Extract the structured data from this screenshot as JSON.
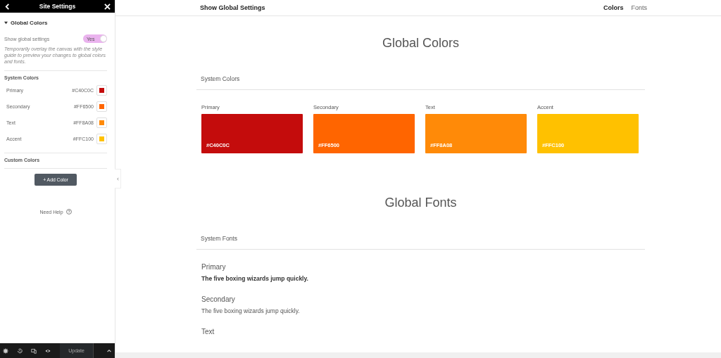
{
  "sidebar": {
    "title": "Site Settings",
    "section": "Global Colors",
    "expanded": true,
    "toggle": {
      "label": "Show global settings",
      "value": "Yes",
      "on": true
    },
    "hint": "Temporarily overlay the canvas with the style guide to preview your changes to global colors and fonts.",
    "system_colors_heading": "System Colors",
    "colors": [
      {
        "name": "Primary",
        "hex": "#C40C0C",
        "color": "#c40c0c"
      },
      {
        "name": "Secondary",
        "hex": "#FF6500",
        "color": "#ff6500"
      },
      {
        "name": "Text",
        "hex": "#FF8A08",
        "color": "#ff8a08"
      },
      {
        "name": "Accent",
        "hex": "#FFC100",
        "color": "#ffc100"
      }
    ],
    "custom_colors_heading": "Custom Colors",
    "add_button": "+ Add Color",
    "help": "Need Help"
  },
  "footer": {
    "update_button": "Update"
  },
  "topbar": {
    "title": "Show Global Settings",
    "tabs": [
      {
        "label": "Colors",
        "selected": true
      },
      {
        "label": "Fonts",
        "selected": false
      }
    ]
  },
  "colors_section": {
    "title": "Global Colors",
    "heading": "System Colors",
    "swatches": [
      {
        "name": "Primary",
        "hex": "#C40C0C",
        "color": "#c40c0c"
      },
      {
        "name": "Secondary",
        "hex": "#FF6500",
        "color": "#ff6500"
      },
      {
        "name": "Text",
        "hex": "#FF8A08",
        "color": "#ff8a08"
      },
      {
        "name": "Accent",
        "hex": "#FFC100",
        "color": "#ffc100"
      }
    ]
  },
  "fonts_section": {
    "title": "Global Fonts",
    "heading": "System Fonts",
    "fonts": [
      {
        "name": "Primary",
        "sample": "The five boxing wizards jump quickly.",
        "bold": true
      },
      {
        "name": "Secondary",
        "sample": "The five boxing wizards jump quickly.",
        "bold": false
      },
      {
        "name": "Text"
      }
    ]
  }
}
